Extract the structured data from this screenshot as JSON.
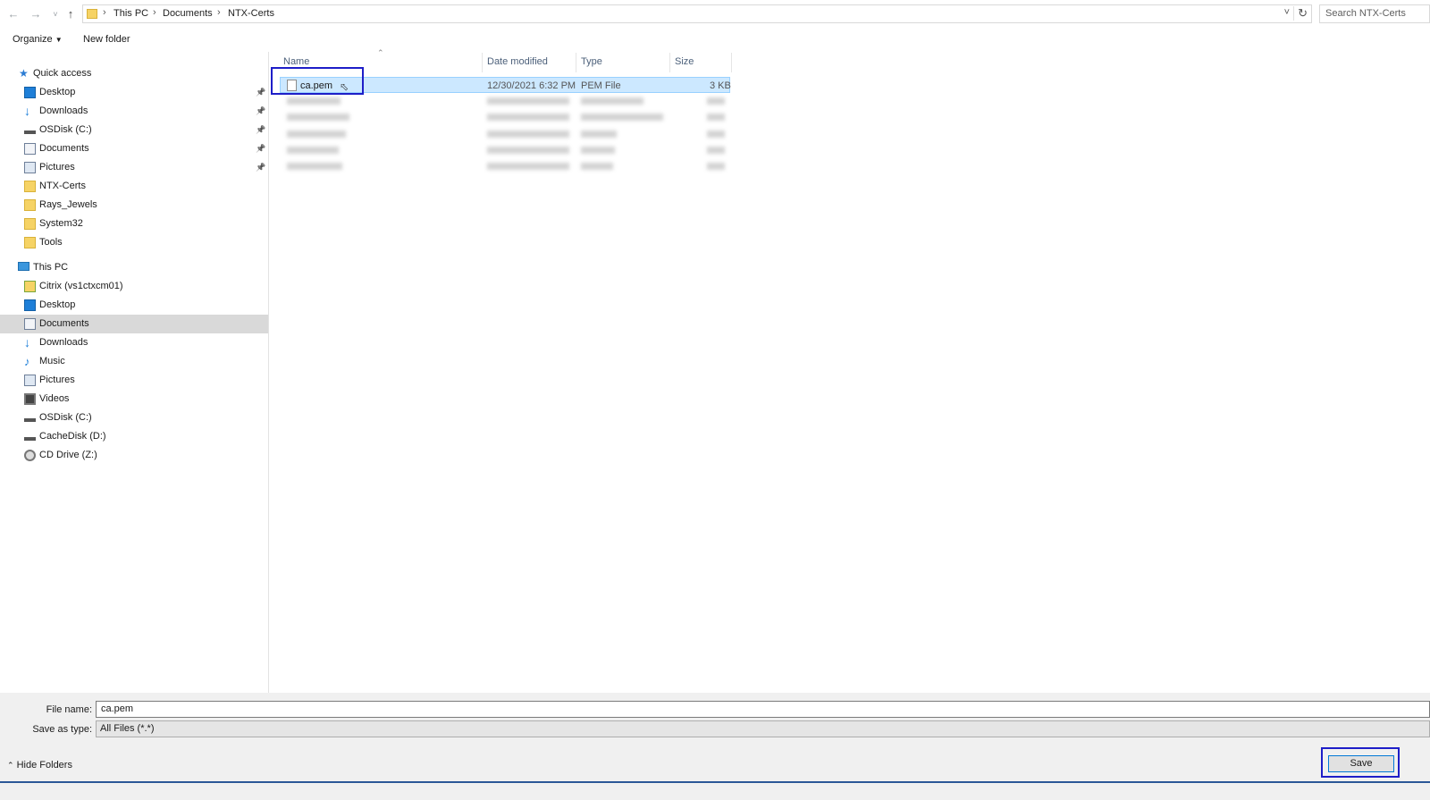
{
  "address": {
    "crumbs": [
      "This PC",
      "Documents",
      "NTX-Certs"
    ],
    "search_placeholder": "Search NTX-Certs"
  },
  "toolbar": {
    "organize_label": "Organize",
    "new_folder_label": "New folder"
  },
  "nav": {
    "quick_access": "Quick access",
    "quick_items": [
      {
        "label": "Desktop",
        "icon": "desktop-icon",
        "pinned": true
      },
      {
        "label": "Downloads",
        "icon": "download-arrow-icon",
        "pinned": true
      },
      {
        "label": "OSDisk (C:)",
        "icon": "drive-icon",
        "pinned": true
      },
      {
        "label": "Documents",
        "icon": "documents-icon",
        "pinned": true
      },
      {
        "label": "Pictures",
        "icon": "pictures-icon",
        "pinned": true
      },
      {
        "label": "NTX-Certs",
        "icon": "folder-icon"
      },
      {
        "label": "Rays_Jewels",
        "icon": "folder-icon"
      },
      {
        "label": "System32",
        "icon": "folder-icon"
      },
      {
        "label": "Tools",
        "icon": "folder-icon"
      }
    ],
    "this_pc": "This PC",
    "pc_items": [
      {
        "label": "Citrix (vs1ctxcm01)",
        "icon": "network-drive-icon"
      },
      {
        "label": "Desktop",
        "icon": "desktop-icon"
      },
      {
        "label": "Documents",
        "icon": "documents-icon",
        "selected": true
      },
      {
        "label": "Downloads",
        "icon": "download-arrow-icon"
      },
      {
        "label": "Music",
        "icon": "music-icon"
      },
      {
        "label": "Pictures",
        "icon": "pictures-icon"
      },
      {
        "label": "Videos",
        "icon": "videos-icon"
      },
      {
        "label": "OSDisk (C:)",
        "icon": "drive-icon"
      },
      {
        "label": "CacheDisk (D:)",
        "icon": "drive-icon"
      },
      {
        "label": "CD Drive (Z:)",
        "icon": "cd-drive-icon"
      }
    ]
  },
  "columns": {
    "name": "Name",
    "date": "Date modified",
    "type": "Type",
    "size": "Size"
  },
  "files": [
    {
      "name": "ca.pem",
      "date": "12/30/2021 6:32 PM",
      "type": "PEM File",
      "size": "3 KB",
      "selected": true
    }
  ],
  "bottom": {
    "file_name_label": "File name:",
    "file_name_value": "ca.pem",
    "save_type_label": "Save as type:",
    "save_type_value": "All Files (*.*)",
    "hide_folders": "Hide Folders",
    "save_label": "Save"
  },
  "colors": {
    "selection": "#cce8ff",
    "highlight_box": "#1e1ec8",
    "accent": "#0078d7"
  }
}
